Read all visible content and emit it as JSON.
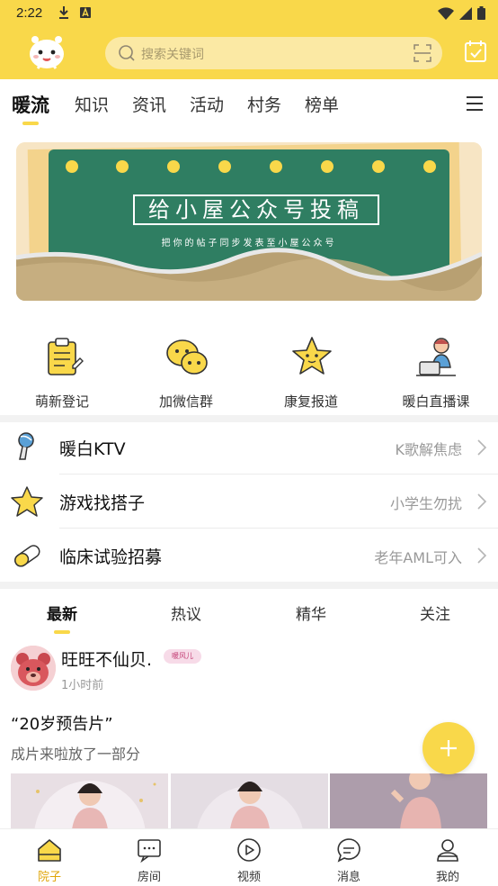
{
  "status_bar": {
    "time": "2:22"
  },
  "header": {
    "search_placeholder": "搜索关键词"
  },
  "top_tabs": [
    {
      "label": "暖流",
      "active": true
    },
    {
      "label": "知识"
    },
    {
      "label": "资讯"
    },
    {
      "label": "活动"
    },
    {
      "label": "村务"
    },
    {
      "label": "榜单"
    }
  ],
  "banner": {
    "title": "给小屋公众号投稿",
    "subtitle": "把你的帖子同步发表至小屋公众号"
  },
  "quick_entries": [
    {
      "label": "萌新登记",
      "icon": "clipboard-icon"
    },
    {
      "label": "加微信群",
      "icon": "wechat-icon"
    },
    {
      "label": "康复报道",
      "icon": "star-mascot-icon"
    },
    {
      "label": "暖白直播课",
      "icon": "live-class-icon"
    }
  ],
  "features": [
    {
      "title": "暖白KTV",
      "tag": "K歌解焦虑",
      "icon": "microphone-icon"
    },
    {
      "title": "游戏找搭子",
      "tag": "小学生勿扰",
      "icon": "star-icon"
    },
    {
      "title": "临床试验招募",
      "tag": "老年AML可入",
      "icon": "pill-icon"
    }
  ],
  "feed_tabs": [
    {
      "label": "最新",
      "active": true
    },
    {
      "label": "热议"
    },
    {
      "label": "精华"
    },
    {
      "label": "关注"
    }
  ],
  "post": {
    "author": "旺旺不仙贝.",
    "badge": "暖风儿",
    "time": "1小时前",
    "title": "“20岁预告片”",
    "body": "成片来啦放了一部分"
  },
  "bottom_nav": [
    {
      "label": "院子",
      "active": true,
      "icon": "house-icon"
    },
    {
      "label": "房间",
      "icon": "chat-room-icon"
    },
    {
      "label": "视频",
      "icon": "play-icon"
    },
    {
      "label": "消息",
      "icon": "message-icon"
    },
    {
      "label": "我的",
      "icon": "profile-icon"
    }
  ],
  "colors": {
    "accent": "#f9d84a",
    "banner_board": "#2f7e62",
    "active_nav": "#e0a60a"
  }
}
